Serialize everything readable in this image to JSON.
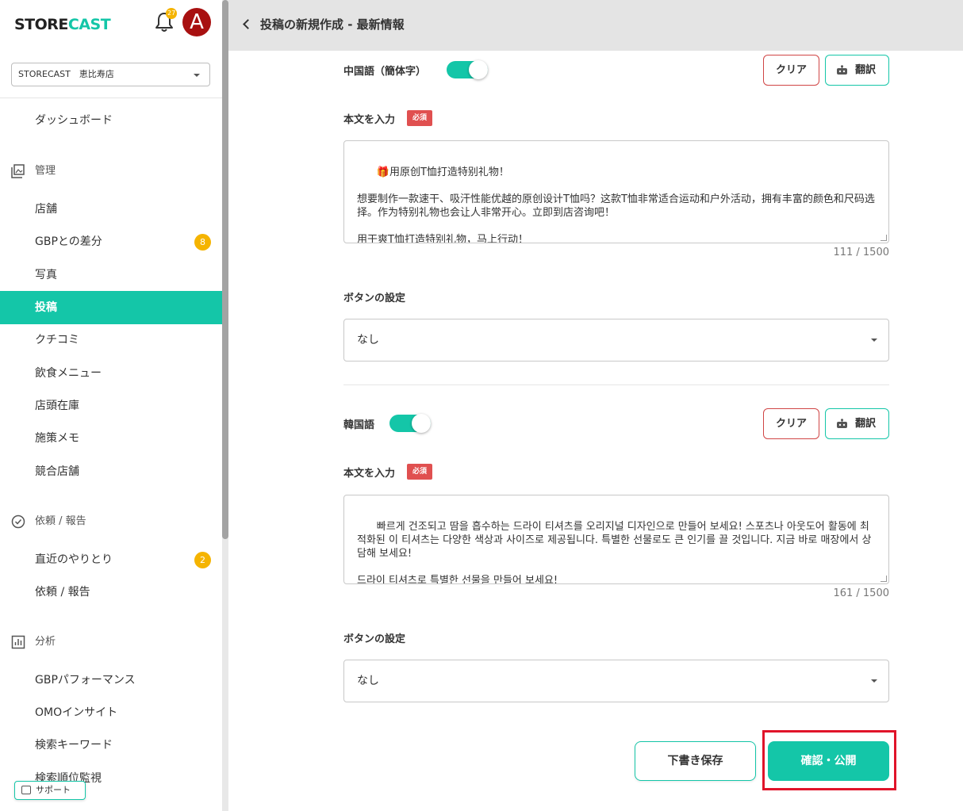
{
  "sidebar": {
    "logo_prefix": "STORE",
    "logo_suffix": "CAST",
    "notification_count": "27",
    "avatar_letter": "A",
    "store_selector": "STORECAST　恵比寿店",
    "items": {
      "dashboard": "ダッシュボード",
      "manage_section": "管理",
      "stores": "店舗",
      "gbp_diff": "GBPとの差分",
      "gbp_diff_count": "8",
      "photos": "写真",
      "posts": "投稿",
      "reviews": "クチコミ",
      "menu": "飲食メニュー",
      "inventory": "店頭在庫",
      "memo": "施策メモ",
      "competitors": "競合店舗",
      "request_section": "依頼 / 報告",
      "recent": "直近のやりとり",
      "recent_count": "2",
      "requests": "依頼 / 報告",
      "analysis_section": "分析",
      "gbp_performance": "GBPパフォーマンス",
      "omo_insight": "OMOインサイト",
      "search_keyword": "検索キーワード",
      "rank_monitor": "検索順位監視"
    },
    "support_label": "サポート"
  },
  "header": {
    "title": "投稿の新規作成 - 最新情報"
  },
  "chinese": {
    "language_label": "中国語（簡体字）",
    "clear_label": "クリア",
    "translate_label": "翻訳",
    "body_label": "本文を入力",
    "required_label": "必須",
    "body_text": "🎁用原创T恤打造特别礼物！\n\n想要制作一款速干、吸汗性能优越的原创设计T恤吗？这款T恤非常适合运动和户外活动，拥有丰富的颜色和尺码选择。作为特别礼物也会让人非常开心。立即到店咨询吧！\n\n用干爽T恤打造特别礼物，马上行动！",
    "char_count": "111 / 1500",
    "button_setting_label": "ボタンの設定",
    "button_setting_value": "なし"
  },
  "korean": {
    "language_label": "韓国語",
    "clear_label": "クリア",
    "translate_label": "翻訳",
    "body_label": "本文を入力",
    "required_label": "必須",
    "body_text": "빠르게 건조되고 땀을 흡수하는 드라이 티셔츠를 오리지널 디자인으로 만들어 보세요! 스포츠나 아웃도어 활동에 최적화된 이 티셔츠는 다양한 색상과 사이즈로 제공됩니다. 특별한 선물로도 큰 인기를 끌 것입니다. 지금 바로 매장에서 상담해 보세요!\n\n드라이 티셔츠로 특별한 선물을 만들어 보세요!",
    "char_count": "161 / 1500",
    "button_setting_label": "ボタンの設定",
    "button_setting_value": "なし"
  },
  "footer": {
    "draft_label": "下書き保存",
    "publish_label": "確認・公開"
  },
  "colors": {
    "accent": "#14c6a8",
    "danger": "#e05050",
    "badge": "#f5b400",
    "highlight": "#e0142a"
  }
}
